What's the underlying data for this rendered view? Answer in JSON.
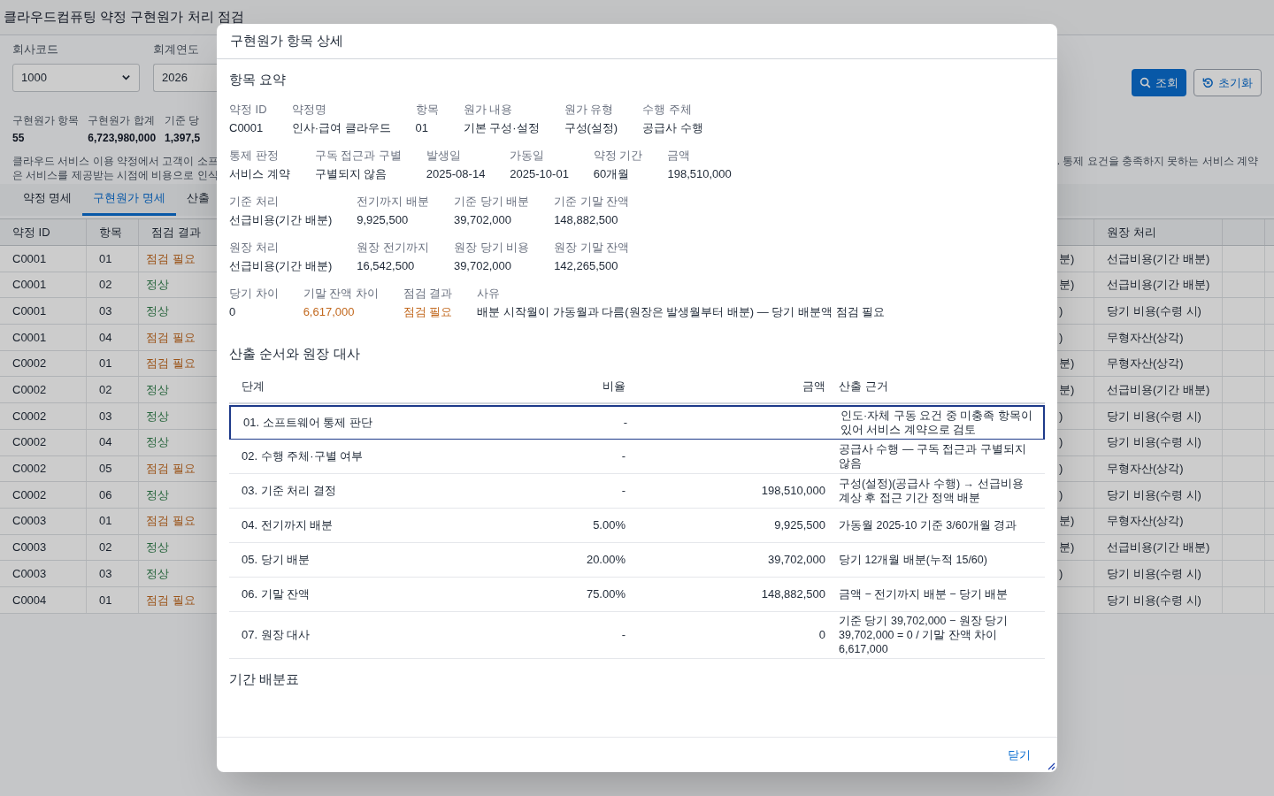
{
  "page": {
    "title": "클라우드컴퓨팅 약정 구현원가 처리 점검"
  },
  "filters": [
    {
      "label": "회사코드",
      "value": "1000",
      "kind": "select"
    },
    {
      "label": "회계연도",
      "value": "2026",
      "kind": "input"
    }
  ],
  "actions": [
    {
      "label": "조회",
      "kind": "primary"
    },
    {
      "label": "초기화",
      "kind": "secondary"
    }
  ],
  "summary": [
    {
      "label": "구현원가 항목",
      "value": "55"
    },
    {
      "label": "구현원가 합계",
      "value": "6,723,980,000"
    },
    {
      "label": "기준 당",
      "value": "1,397,5"
    }
  ],
  "description": {
    "left_lines": [
      "클라우드 서비스 이용 약정에서 고객이 소프",
      "은 서비스를 제공받는 시점에 비용으로 인식"
    ],
    "right_fragment": ". 통제 요건을 충족하지 못하는 서비스 계약"
  },
  "tabs": [
    {
      "label": "약정 명세",
      "selected": false
    },
    {
      "label": "구현원가 명세",
      "selected": true
    },
    {
      "label": "산출",
      "selected": false
    }
  ],
  "table": {
    "columns": [
      "약정 ID",
      "항목",
      "점검 결과",
      "원장 처리"
    ],
    "rows": [
      {
        "contract_id": "C0001",
        "item": "01",
        "result": "점검 필요",
        "needs_check": true,
        "column_4": "분)",
        "ledger": "선급비용(기간 배분)"
      },
      {
        "contract_id": "C0001",
        "item": "02",
        "result": "정상",
        "needs_check": false,
        "column_4": "분)",
        "ledger": "선급비용(기간 배분)"
      },
      {
        "contract_id": "C0001",
        "item": "03",
        "result": "정상",
        "needs_check": false,
        "column_4": ")",
        "ledger": "당기 비용(수령 시)"
      },
      {
        "contract_id": "C0001",
        "item": "04",
        "result": "점검 필요",
        "needs_check": true,
        "column_4": ")",
        "ledger": "무형자산(상각)"
      },
      {
        "contract_id": "C0002",
        "item": "01",
        "result": "점검 필요",
        "needs_check": true,
        "column_4": "분)",
        "ledger": "무형자산(상각)"
      },
      {
        "contract_id": "C0002",
        "item": "02",
        "result": "정상",
        "needs_check": false,
        "column_4": "분)",
        "ledger": "선급비용(기간 배분)"
      },
      {
        "contract_id": "C0002",
        "item": "03",
        "result": "정상",
        "needs_check": false,
        "column_4": ")",
        "ledger": "당기 비용(수령 시)"
      },
      {
        "contract_id": "C0002",
        "item": "04",
        "result": "정상",
        "needs_check": false,
        "column_4": ")",
        "ledger": "당기 비용(수령 시)"
      },
      {
        "contract_id": "C0002",
        "item": "05",
        "result": "점검 필요",
        "needs_check": true,
        "column_4": ")",
        "ledger": "무형자산(상각)"
      },
      {
        "contract_id": "C0002",
        "item": "06",
        "result": "정상",
        "needs_check": false,
        "column_4": ")",
        "ledger": "당기 비용(수령 시)"
      },
      {
        "contract_id": "C0003",
        "item": "01",
        "result": "점검 필요",
        "needs_check": true,
        "column_4": "분)",
        "ledger": "무형자산(상각)"
      },
      {
        "contract_id": "C0003",
        "item": "02",
        "result": "정상",
        "needs_check": false,
        "column_4": "분)",
        "ledger": "선급비용(기간 배분)"
      },
      {
        "contract_id": "C0003",
        "item": "03",
        "result": "정상",
        "needs_check": false,
        "column_4": ")",
        "ledger": "당기 비용(수령 시)"
      },
      {
        "contract_id": "C0004",
        "item": "01",
        "result": "점검 필요",
        "needs_check": true,
        "ledger": "당기 비용(수령 시)"
      }
    ]
  },
  "modal": {
    "title": "구현원가 항목 상세",
    "summary_heading": "항목 요약",
    "field_rows": [
      [
        {
          "label": "약정 ID",
          "value": "C0001",
          "warning": false
        },
        {
          "label": "약정명",
          "value": "인사·급여 클라우드",
          "warning": false
        },
        {
          "label": "항목",
          "value": "01",
          "warning": false
        },
        {
          "label": "원가 내용",
          "value": "기본 구성·설정",
          "warning": false
        },
        {
          "label": "원가 유형",
          "value": "구성(설정)",
          "warning": false
        },
        {
          "label": "수행 주체",
          "value": "공급사 수행",
          "warning": false
        }
      ],
      [
        {
          "label": "통제 판정",
          "value": "서비스 계약",
          "warning": false
        },
        {
          "label": "구독 접근과 구별",
          "value": "구별되지 않음",
          "warning": false
        },
        {
          "label": "발생일",
          "value": "2025-08-14",
          "warning": false
        },
        {
          "label": "가동일",
          "value": "2025-10-01",
          "warning": false
        },
        {
          "label": "약정 기간",
          "value": "60개월",
          "warning": false
        },
        {
          "label": "금액",
          "value": "198,510,000",
          "warning": false
        }
      ],
      [
        {
          "label": "기준 처리",
          "value": "선급비용(기간 배분)",
          "warning": false
        },
        {
          "label": "전기까지 배분",
          "value": "9,925,500",
          "warning": false
        },
        {
          "label": "기준 당기 배분",
          "value": "39,702,000",
          "warning": false
        },
        {
          "label": "기준 기말 잔액",
          "value": "148,882,500",
          "warning": false
        }
      ],
      [
        {
          "label": "원장 처리",
          "value": "선급비용(기간 배분)",
          "warning": false
        },
        {
          "label": "원장 전기까지",
          "value": "16,542,500",
          "warning": false
        },
        {
          "label": "원장 당기 비용",
          "value": "39,702,000",
          "warning": false
        },
        {
          "label": "원장 기말 잔액",
          "value": "142,265,500",
          "warning": false
        }
      ],
      [
        {
          "label": "당기 차이",
          "value": "0",
          "warning": false
        },
        {
          "label": "기말 잔액 차이",
          "value": "6,617,000",
          "warning": true
        },
        {
          "label": "점검 결과",
          "value": "점검 필요",
          "warning": true
        },
        {
          "label": "사유",
          "value": "배분 시작월이 가동월과 다름(원장은 발생월부터 배분) — 당기 배분액 점검 필요",
          "warning": false
        }
      ]
    ],
    "steps_heading": "산출 순서와 원장 대사",
    "steps_columns": [
      "단계",
      "비율",
      "금액",
      "산출 근거"
    ],
    "steps": [
      {
        "step": "01. 소프트웨어 통제 판단",
        "ratio": "-",
        "basis": "인도·자체 구동 요건 중 미충족 항목이 있어 서비스 계약으로 검토",
        "selected": true
      },
      {
        "step": "02. 수행 주체·구별 여부",
        "ratio": "-",
        "basis": "공급사 수행 — 구독 접근과 구별되지 않음",
        "selected": false
      },
      {
        "step": "03. 기준 처리 결정",
        "ratio": "-",
        "amount": "198,510,000",
        "basis": "구성(설정)(공급사 수행) → 선급비용 계상 후 접근 기간 정액 배분",
        "selected": false
      },
      {
        "step": "04. 전기까지 배분",
        "ratio": "5.00%",
        "amount": "9,925,500",
        "basis": "가동월 2025-10 기준 3/60개월 경과",
        "selected": false
      },
      {
        "step": "05. 당기 배분",
        "ratio": "20.00%",
        "amount": "39,702,000",
        "basis": "당기 12개월 배분(누적 15/60)",
        "selected": false
      },
      {
        "step": "06. 기말 잔액",
        "ratio": "75.00%",
        "amount": "148,882,500",
        "basis": "금액 − 전기까지 배분 − 당기 배분",
        "selected": false
      },
      {
        "step": "07. 원장 대사",
        "ratio": "-",
        "amount": "0",
        "basis": "기준 당기 39,702,000 − 원장 당기 39,702,000 = 0 / 기말 잔액 차이 6,617,000",
        "selected": false
      }
    ],
    "schedule_heading": "기간 배분표",
    "close_label": "닫기"
  }
}
